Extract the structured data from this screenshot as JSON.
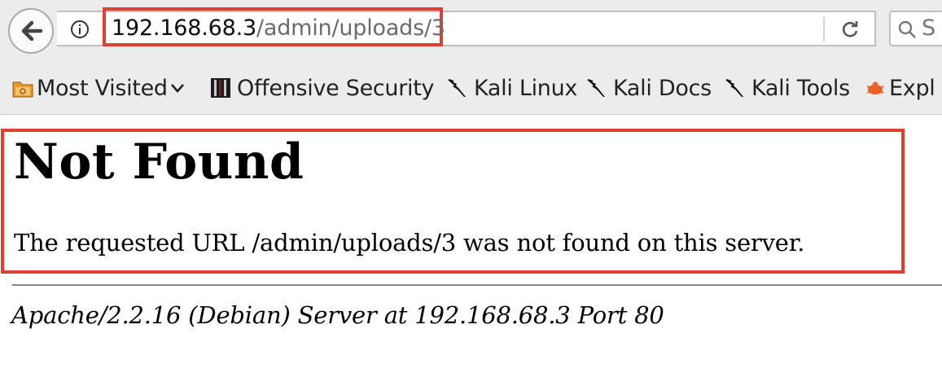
{
  "browser": {
    "url": {
      "host": "192.168.68.3",
      "path": "/admin/uploads/3"
    },
    "search_placeholder": "S",
    "bookmarks": [
      {
        "label": "Most Visited",
        "icon": "folder-icon"
      },
      {
        "label": "Offensive Security",
        "icon": "offsec-icon"
      },
      {
        "label": "Kali Linux",
        "icon": "kali-dragon-icon"
      },
      {
        "label": "Kali Docs",
        "icon": "kali-dragon-icon"
      },
      {
        "label": "Kali Tools",
        "icon": "kali-dragon-icon"
      },
      {
        "label": "Expl",
        "icon": "exploit-db-icon"
      }
    ],
    "highlight_color": "#e0412e"
  },
  "page": {
    "heading": "Not Found",
    "message": "The requested URL /admin/uploads/3 was not found on this server.",
    "address": "Apache/2.2.16 (Debian) Server at 192.168.68.3 Port 80"
  }
}
